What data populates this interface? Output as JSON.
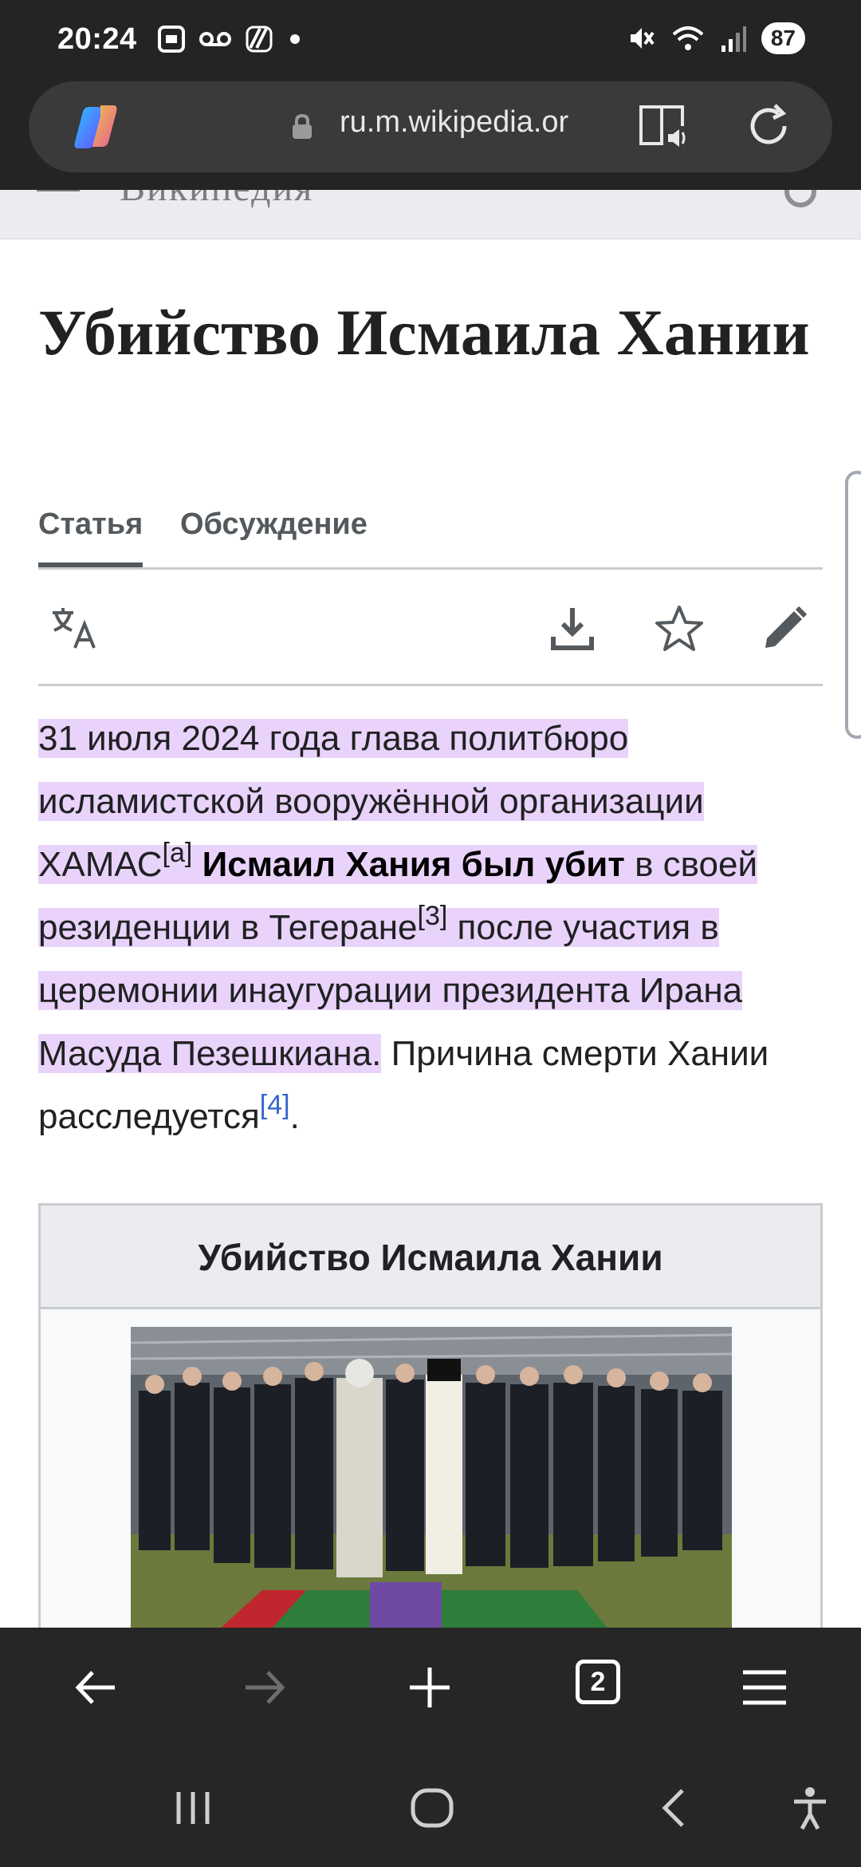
{
  "status_bar": {
    "time": "20:24",
    "battery": "87",
    "left_icons": [
      "screenshot-icon",
      "voicemail-icon",
      "translate-badge-icon",
      "dot-icon"
    ],
    "right_icons": [
      "mute-icon",
      "wifi-icon",
      "signal-icon"
    ]
  },
  "url_bar": {
    "url": "ru.m.wikipedia.or",
    "icons": [
      "copilot-icon",
      "lock-icon",
      "reader-mode-icon",
      "reload-icon"
    ]
  },
  "wiki_header": {
    "brand": "Википедия"
  },
  "article": {
    "title": "Убийство Исмаила Хании",
    "tabs": [
      {
        "label": "Статья",
        "active": true
      },
      {
        "label": "Обсуждение",
        "active": false
      }
    ],
    "actions": [
      "language-icon",
      "download-icon",
      "watch-star-icon",
      "edit-icon"
    ],
    "lead": {
      "p1": "31 июля 2024 года глава политбюро исламистской вооружённой организации ХАМАС",
      "note_a": "[a]",
      "bold": "Исмаил Хания был убит",
      "p2": " в своей резиденции в Тегеране",
      "note_3": "[3]",
      "p3": " после участия в церемонии инаугурации президента Ирана Масуда Пезешкиана.",
      "p4": " Причина смерти Хании расследуется",
      "note_4": "[4]",
      "p5": "."
    },
    "infobox": {
      "title": "Убийство Исмаила Хании"
    }
  },
  "bottom_toolbar": {
    "tab_count": "2",
    "buttons": [
      "back-icon",
      "forward-icon",
      "new-tab-icon",
      "tabs-icon",
      "menu-icon"
    ]
  },
  "colors": {
    "chrome_bg": "#242424",
    "highlight": "#e9d3fb",
    "link": "#3366cc",
    "text": "#202122"
  }
}
